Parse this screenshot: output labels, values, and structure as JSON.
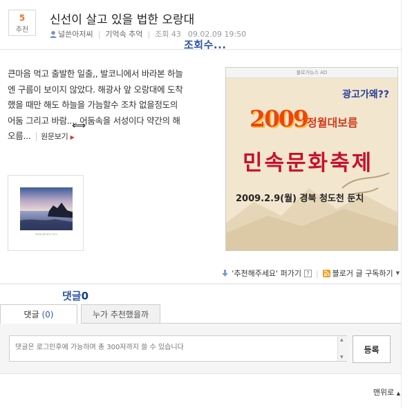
{
  "post": {
    "recommend_count": "5",
    "recommend_label": "추천",
    "title": "신선이 살고 있을 법한 오랑대",
    "author": "널쓴아저씨",
    "category": "기억속 추억",
    "views_label": "조회 43",
    "date": "09.02.09 19:50",
    "views_overlay": "조회수...",
    "body_lines": [
      "큰마음 먹고 출발한 일출,, 발코니에서 바라본 하늘",
      "엔 구름이 보이지 않았다. 해광사 앞 오랑대에 도착",
      "했을 때만 해도 하늘을 가늠할수 조차 없을정도의",
      "어둠 그리고 바람.... 어둠속을 서성이다 약간의 해",
      "오름..."
    ],
    "original_link": "원문보기",
    "thumb_caption": "www.photo.com"
  },
  "ad": {
    "header": "블로거뉴스 AD",
    "why": "광고가왜??",
    "year": "2009",
    "event": "정월대보름",
    "festival": "민속문화축제",
    "date_place": "2009.2.9(월) 경북 청도천 둔치"
  },
  "actions": {
    "recommend": "'추천해주세요' 퍼가기",
    "help": "?",
    "subscribe": "블로거 글 구독하기"
  },
  "comments": {
    "overlay_prefix": "댓글",
    "overlay_count": "0",
    "tab_comments": "댓글",
    "tab_comments_count": "(0)",
    "tab_who": "누가 추천했을까",
    "placeholder": "댓글은 로그인후에 가능하며 총 300자까지 쓸 수 있습니다",
    "submit": "등록"
  },
  "footer": {
    "to_top": "맨위로"
  }
}
